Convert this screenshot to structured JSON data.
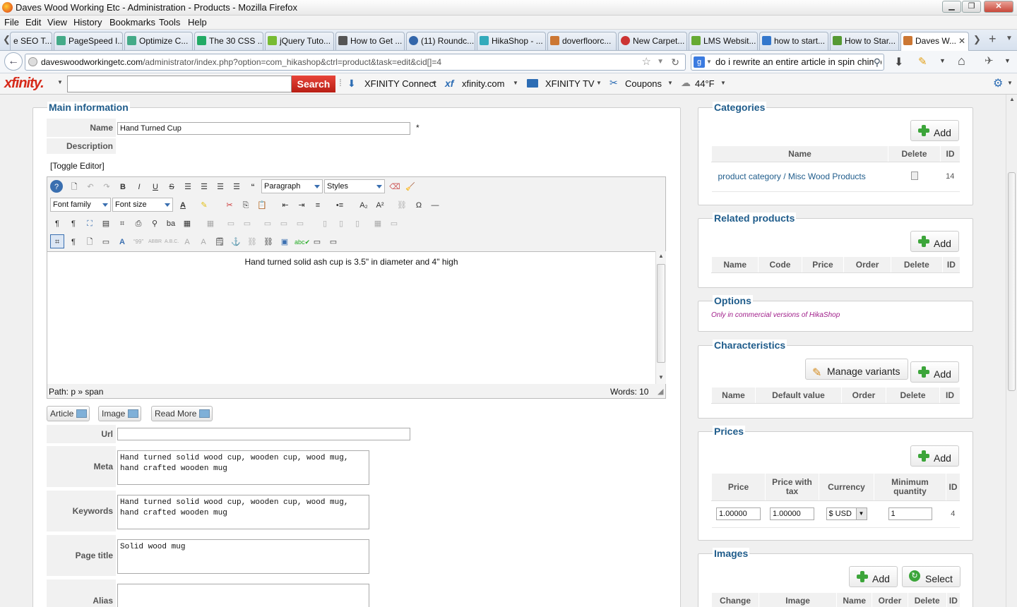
{
  "window": {
    "title": "Daves Wood Working Etc - Administration - Products - Mozilla Firefox",
    "min": "▁",
    "max": "❐",
    "close": "✕"
  },
  "menu": [
    "File",
    "Edit",
    "View",
    "History",
    "Bookmarks",
    "Tools",
    "Help"
  ],
  "tabs": [
    {
      "label": "e SEO T...",
      "color": "#d33"
    },
    {
      "label": "PageSpeed I...",
      "color": "#4a8"
    },
    {
      "label": "Optimize C...",
      "color": "#4a8"
    },
    {
      "label": "The 30 CSS ...",
      "color": "#2a6"
    },
    {
      "label": "jQuery Tuto...",
      "color": "#7b3"
    },
    {
      "label": "How to Get ...",
      "color": "#555"
    },
    {
      "label": "(11) Roundc...",
      "color": "#36a"
    },
    {
      "label": "HikaShop - ...",
      "color": "#3ab"
    },
    {
      "label": "doverfloorc...",
      "color": "#c73"
    },
    {
      "label": "New Carpet...",
      "color": "#c33"
    },
    {
      "label": "LMS Websit...",
      "color": "#6a3"
    },
    {
      "label": "how to start...",
      "color": "#37c"
    },
    {
      "label": "How to Star...",
      "color": "#593"
    },
    {
      "label": "Daves W...",
      "color": "#c73"
    }
  ],
  "url": {
    "domain": "daveswoodworkingetc.com",
    "path": "/administrator/index.php?option=com_hikashop&ctrl=product&task=edit&cid[]=4"
  },
  "websearch": "do i rewrite an entire article in spin chimp",
  "xfinity": {
    "logo": "xfinity.",
    "search": "Search",
    "items": [
      "XFINITY Connect",
      "xfinity.com",
      "XFINITY TV",
      "Coupons",
      "44°F"
    ]
  },
  "main": {
    "legend": "Main information",
    "name_label": "Name",
    "name_value": "Hand Turned Cup",
    "required": "*",
    "desc_label": "Description",
    "toggle": "[Toggle Editor]",
    "format_select": "Paragraph",
    "styles_select": "Styles",
    "font_family": "Font family",
    "font_size": "Font size",
    "content": "Hand turned solid ash cup is 3.5\" in diameter and 4\" high",
    "path": "Path:  p » span",
    "words": "Words: 10",
    "btn_article": "Article",
    "btn_image": "Image",
    "btn_readmore": "Read More",
    "url_label": "Url",
    "meta_label": "Meta description",
    "meta_value": "Hand turned solid wood cup, wooden cup, wood mug,\nhand crafted wooden mug",
    "kw_label": "Keywords",
    "kw_value": "Hand turned solid wood cup, wooden cup, wood mug,\nhand crafted wooden mug",
    "pt_label": "Page title",
    "pt_value": "Solid wood mug",
    "alias_label": "Alias"
  },
  "categories": {
    "legend": "Categories",
    "add": "Add",
    "cols": [
      "Name",
      "Delete",
      "ID"
    ],
    "row": {
      "name": "product category / Misc Wood Products",
      "id": "14"
    }
  },
  "related": {
    "legend": "Related products",
    "add": "Add",
    "cols": [
      "Name",
      "Code",
      "Price",
      "Order",
      "Delete",
      "ID"
    ]
  },
  "options": {
    "legend": "Options",
    "note": "Only in commercial versions of HikaShop"
  },
  "characteristics": {
    "legend": "Characteristics",
    "manage": "Manage variants",
    "add": "Add",
    "cols": [
      "Name",
      "Default value",
      "Order",
      "Delete",
      "ID"
    ]
  },
  "prices": {
    "legend": "Prices",
    "add": "Add",
    "cols": [
      "Price",
      "Price with tax",
      "Currency",
      "Minimum quantity",
      "ID"
    ],
    "row": {
      "price": "1.00000",
      "price_tax": "1.00000",
      "currency": "$ USD",
      "min_qty": "1",
      "id": "4"
    }
  },
  "images": {
    "legend": "Images",
    "add": "Add",
    "select": "Select",
    "cols": [
      "Change",
      "Image",
      "Name",
      "Order",
      "Delete",
      "ID"
    ]
  }
}
